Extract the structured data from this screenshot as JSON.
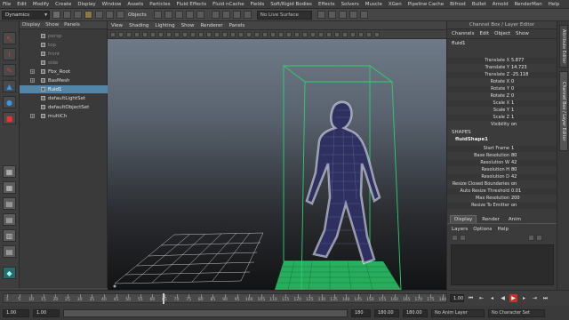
{
  "menubar": {
    "items": [
      "File",
      "Edit",
      "Modify",
      "Create",
      "Display",
      "Window",
      "Assets",
      "Particles",
      "Fluid Effects",
      "Fluid nCache",
      "Fields",
      "Soft/Rigid Bodies",
      "Effects",
      "Solvers",
      "Muscle",
      "XGen",
      "Pipeline Cache",
      "Bifrost",
      "Bullet",
      "Arnold",
      "RenderMan",
      "Help"
    ]
  },
  "toolbar": {
    "mode": "Dynamics",
    "objects_label": "Objects",
    "live_surface": "No Live Surface"
  },
  "outliner": {
    "menu": [
      "Display",
      "Show",
      "Panels"
    ],
    "items": [
      {
        "label": "persp",
        "dim": true,
        "selected": false,
        "expand": false
      },
      {
        "label": "top",
        "dim": true,
        "selected": false,
        "expand": false
      },
      {
        "label": "front",
        "dim": true,
        "selected": false,
        "expand": false
      },
      {
        "label": "side",
        "dim": true,
        "selected": false,
        "expand": false
      },
      {
        "label": "Fbx_Root",
        "dim": false,
        "selected": false,
        "expand": true
      },
      {
        "label": "BasMesh",
        "dim": false,
        "selected": false,
        "expand": true
      },
      {
        "label": "fluid1",
        "dim": false,
        "selected": true,
        "expand": false
      },
      {
        "label": "defaultLightSet",
        "dim": false,
        "selected": false,
        "expand": false
      },
      {
        "label": "defaultObjectSet",
        "dim": false,
        "selected": false,
        "expand": false
      },
      {
        "label": "multiCh",
        "dim": false,
        "selected": false,
        "expand": true
      }
    ]
  },
  "viewport": {
    "menu": [
      "View",
      "Shading",
      "Lighting",
      "Show",
      "Renderer",
      "Panels"
    ]
  },
  "channel_box": {
    "title": "Channel Box / Layer Editor",
    "menu": [
      "Channels",
      "Edit",
      "Object",
      "Show"
    ],
    "object": "fluid1",
    "attributes": [
      {
        "name": "Translate X",
        "value": "5.877"
      },
      {
        "name": "Translate Y",
        "value": "14.723"
      },
      {
        "name": "Translate Z",
        "value": "-25.118"
      },
      {
        "name": "Rotate X",
        "value": "0"
      },
      {
        "name": "Rotate Y",
        "value": "0"
      },
      {
        "name": "Rotate Z",
        "value": "0"
      },
      {
        "name": "Scale X",
        "value": "1"
      },
      {
        "name": "Scale Y",
        "value": "1"
      },
      {
        "name": "Scale Z",
        "value": "1"
      },
      {
        "name": "Visibility",
        "value": "on"
      }
    ],
    "shapes_header": "SHAPES",
    "shape_name": "fluidShape1",
    "shape_attributes": [
      {
        "name": "Start Frame",
        "value": "1"
      },
      {
        "name": "Base Resolution",
        "value": "80"
      },
      {
        "name": "Resolution W",
        "value": "42"
      },
      {
        "name": "Resolution H",
        "value": "80"
      },
      {
        "name": "Resolution D",
        "value": "42"
      },
      {
        "name": "Resize Closed Boundaries",
        "value": "on"
      },
      {
        "name": "Auto Resize Threshold",
        "value": "0.01"
      },
      {
        "name": "Max Resolution",
        "value": "200"
      },
      {
        "name": "Resize To Emitter",
        "value": "on"
      }
    ],
    "layer_tabs": [
      "Display",
      "Render",
      "Anim"
    ],
    "layer_menu": [
      "Layers",
      "Options",
      "Help"
    ]
  },
  "side_tabs": [
    "Attribute Editor",
    "Channel Box / Layer Editor"
  ],
  "timeline": {
    "ticks": [
      "1",
      "5",
      "10",
      "15",
      "20",
      "25",
      "30",
      "35",
      "40",
      "45",
      "50",
      "55",
      "60",
      "65",
      "70",
      "75",
      "80",
      "85",
      "90",
      "95",
      "100",
      "105",
      "110",
      "115",
      "120",
      "125",
      "130",
      "135",
      "140",
      "145",
      "150",
      "155",
      "160",
      "165",
      "170",
      "175",
      "180"
    ],
    "current_frame_position": 0.36,
    "current_frame": "1.00"
  },
  "range": {
    "start": "1.00",
    "inner_start": "1.00",
    "inner_end": "180",
    "end_a": "180.00",
    "end_b": "180.00",
    "anim_layer": "No Anim Layer",
    "char_set": "No Character Set"
  }
}
